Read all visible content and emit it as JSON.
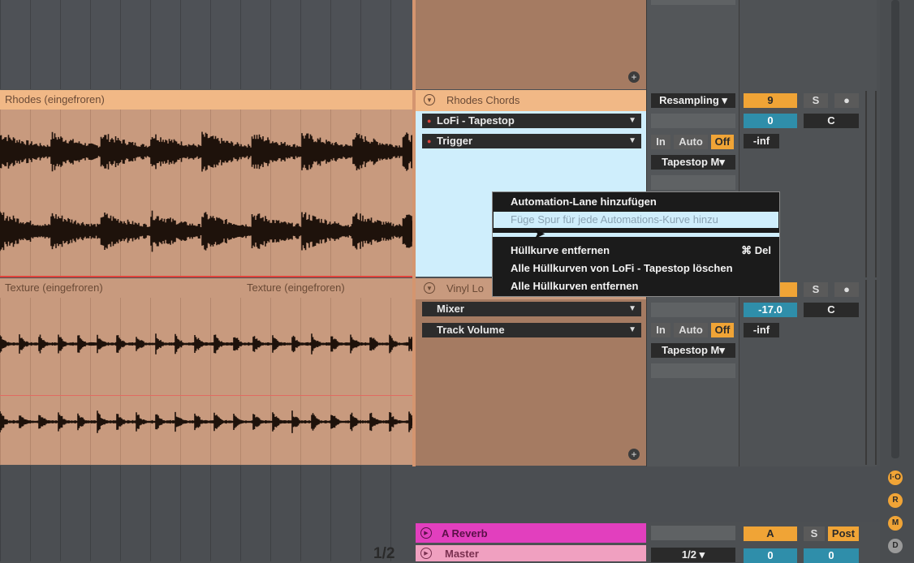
{
  "clips": {
    "rhodes_title": "Rhodes (eingefroren)",
    "texture_title_1": "Texture (eingefroren)",
    "texture_title_2": "Texture (eingefroren)"
  },
  "tracks": {
    "rhodes": {
      "name": "Rhodes Chords",
      "device_chooser": "LoFi - Tapestop",
      "param_chooser": "Trigger",
      "input_type": "Resampling",
      "monitor_in": "In",
      "monitor_auto": "Auto",
      "monitor_off": "Off",
      "output": "Tapestop M",
      "track_number": "9",
      "solo": "S",
      "volume": "0",
      "pan": "C",
      "peak": "-inf"
    },
    "vinyl": {
      "name": "Vinyl Lo",
      "device_chooser": "Mixer",
      "param_chooser": "Track Volume",
      "monitor_in": "In",
      "monitor_auto": "Auto",
      "monitor_off": "Off",
      "output": "Tapestop M",
      "solo": "S",
      "volume": "-17.0",
      "pan": "C",
      "peak": "-inf"
    },
    "a_reverb": {
      "name": "A Reverb",
      "send_letter": "A",
      "solo": "S",
      "post": "Post"
    },
    "master": {
      "name": "Master",
      "output": "1/2",
      "volume_left": "0",
      "volume_right": "0"
    }
  },
  "arrangement": {
    "page_indicator": "1/2"
  },
  "context_menu": {
    "items": [
      "Automation-Lane hinzufügen",
      "Füge Spur für jede Automations-Kurve hinzu",
      "Hüllkurve entfernen",
      "Alle Hüllkurven von LoFi - Tapestop löschen",
      "Alle Hüllkurven entfernen"
    ],
    "shortcut": "⌘ Del"
  },
  "side_buttons": [
    "I·O",
    "R",
    "M",
    "D"
  ],
  "colors": {
    "clip_orange": "#f1b886",
    "clip_brown": "#c89a7e",
    "track_tan": "#a57b62",
    "highlight_blue": "#cfeefc",
    "reverb_pink": "#e23fbe",
    "master_pink": "#f0a0c0",
    "accent_orange": "#f0a436",
    "accent_teal": "#2f8eaa"
  }
}
